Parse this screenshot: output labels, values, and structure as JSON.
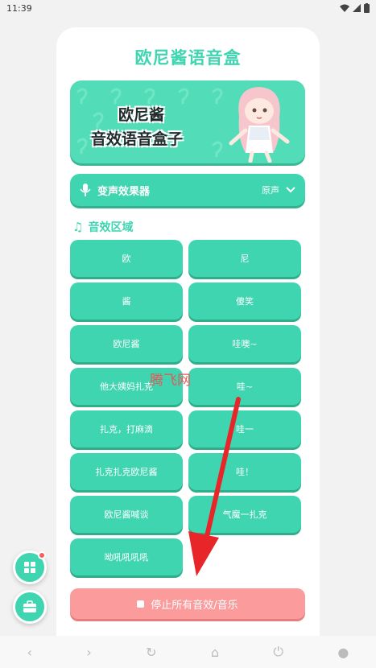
{
  "status": {
    "time": "11:39"
  },
  "app": {
    "title": "欧尼酱语音盒"
  },
  "banner": {
    "line1": "欧尼酱",
    "line2": "音效语音盒子"
  },
  "voice_changer": {
    "label": "变声效果器",
    "value": "原声"
  },
  "sound_section": {
    "title": "音效区域"
  },
  "sounds": [
    "欧",
    "尼",
    "酱",
    "傻笑",
    "欧尼酱",
    "哇噢~",
    "他大姨妈扎克",
    "哇~",
    "扎克，打麻滴",
    "哇一",
    "扎克扎克欧尼酱",
    "哇！",
    "欧尼酱喊谈",
    "气魔一扎克",
    "呦吼吼吼吼"
  ],
  "stop_button": {
    "label": "停止所有音效/音乐"
  },
  "watermark": "腾飞网",
  "colors": {
    "accent": "#3fd5b0",
    "stop": "#fc9b9b",
    "arrow": "#e8262a"
  },
  "icons": [
    "wifi-icon",
    "signal-icon",
    "battery-icon",
    "mic-icon",
    "chevron-down-icon",
    "music-note-icon",
    "stop-square-icon",
    "grid-icon",
    "toolbox-icon",
    "back-icon",
    "forward-icon",
    "refresh-icon",
    "home-icon",
    "power-icon",
    "circle-icon"
  ]
}
